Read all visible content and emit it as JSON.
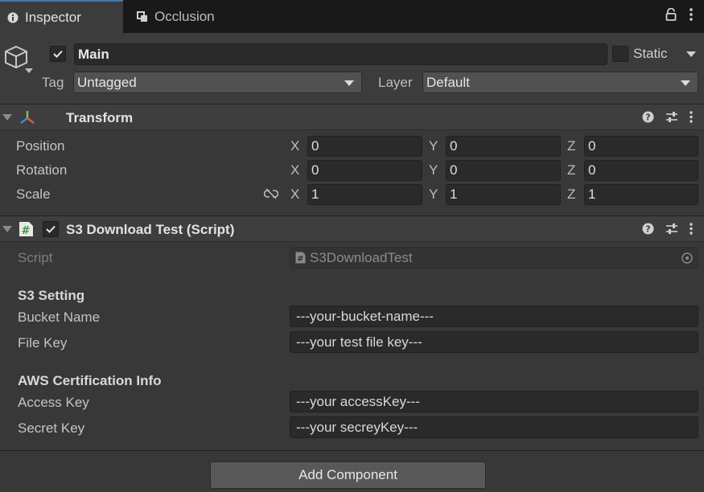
{
  "tabs": [
    {
      "label": "Inspector",
      "icon": "info-icon"
    },
    {
      "label": "Occlusion",
      "icon": "occlusion-icon"
    }
  ],
  "object": {
    "name": "Main",
    "active": true,
    "static_label": "Static",
    "tag_label": "Tag",
    "tag_value": "Untagged",
    "layer_label": "Layer",
    "layer_value": "Default"
  },
  "transform": {
    "title": "Transform",
    "rows": [
      {
        "label": "Position",
        "x": "0",
        "y": "0",
        "z": "0"
      },
      {
        "label": "Rotation",
        "x": "0",
        "y": "0",
        "z": "0"
      },
      {
        "label": "Scale",
        "x": "1",
        "y": "1",
        "z": "1"
      }
    ],
    "axes": [
      "X",
      "Y",
      "Z"
    ]
  },
  "script_component": {
    "title": "S3 Download Test (Script)",
    "enabled": true,
    "script_label": "Script",
    "script_value": "S3DownloadTest",
    "s3_header": "S3 Setting",
    "bucket_label": "Bucket Name",
    "bucket_value": "---your-bucket-name---",
    "filekey_label": "File Key",
    "filekey_value": "---your test file key---",
    "aws_header": "AWS Certification Info",
    "access_label": "Access Key",
    "access_value": "---your accessKey---",
    "secret_label": "Secret Key",
    "secret_value": "---your secreyKey---"
  },
  "footer": {
    "add_component_label": "Add Component"
  },
  "colors": {
    "accent": "#3a79bb",
    "background": "#383838",
    "tabbar": "#191919"
  }
}
